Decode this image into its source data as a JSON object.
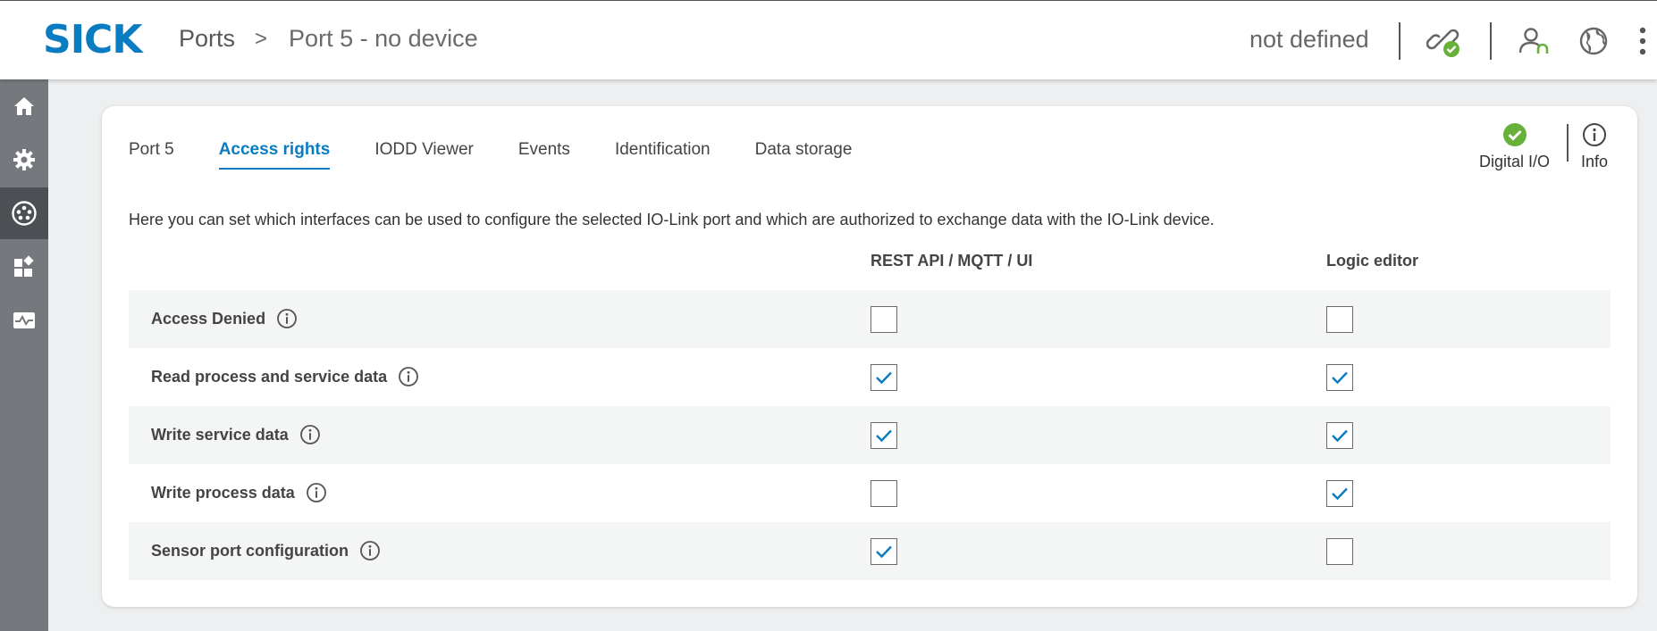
{
  "header": {
    "logo": "SICK",
    "breadcrumb": [
      "Ports",
      "Port 5 - no device"
    ],
    "breadcrumb_separator": ">",
    "user_status": "not defined",
    "icons": [
      "link-connected-icon",
      "user-icon",
      "globe-icon",
      "more-vertical-icon"
    ],
    "connection_status_color": "#67b13b"
  },
  "sidebar": {
    "items": [
      {
        "name": "home",
        "icon": "home-icon"
      },
      {
        "name": "settings",
        "icon": "gear-icon"
      },
      {
        "name": "ports",
        "icon": "io-link-ports-icon",
        "active": true
      },
      {
        "name": "apps",
        "icon": "apps-icon"
      },
      {
        "name": "monitoring",
        "icon": "pulse-monitor-icon"
      }
    ]
  },
  "tabs": [
    {
      "label": "Port 5"
    },
    {
      "label": "Access rights",
      "active": true
    },
    {
      "label": "IODD Viewer"
    },
    {
      "label": "Events"
    },
    {
      "label": "Identification"
    },
    {
      "label": "Data storage"
    }
  ],
  "status": {
    "mode_label": "Digital I/O",
    "info_label": "Info",
    "ok_color": "#67b13b"
  },
  "description": "Here you can set which interfaces can be used to configure the selected IO-Link port and which are authorized to exchange data with the IO-Link device.",
  "columns": [
    "REST API / MQTT / UI",
    "Logic editor"
  ],
  "rows": [
    {
      "label": "Access Denied",
      "rest": false,
      "logic": false
    },
    {
      "label": "Read process and service data",
      "rest": true,
      "logic": true
    },
    {
      "label": "Write service data",
      "rest": true,
      "logic": true
    },
    {
      "label": "Write process data",
      "rest": false,
      "logic": true
    },
    {
      "label": "Sensor port configuration",
      "rest": true,
      "logic": false
    }
  ],
  "colors": {
    "accent": "#0a7cc1",
    "sidebar": "#75797d",
    "sidebar_active": "#4c5054"
  }
}
